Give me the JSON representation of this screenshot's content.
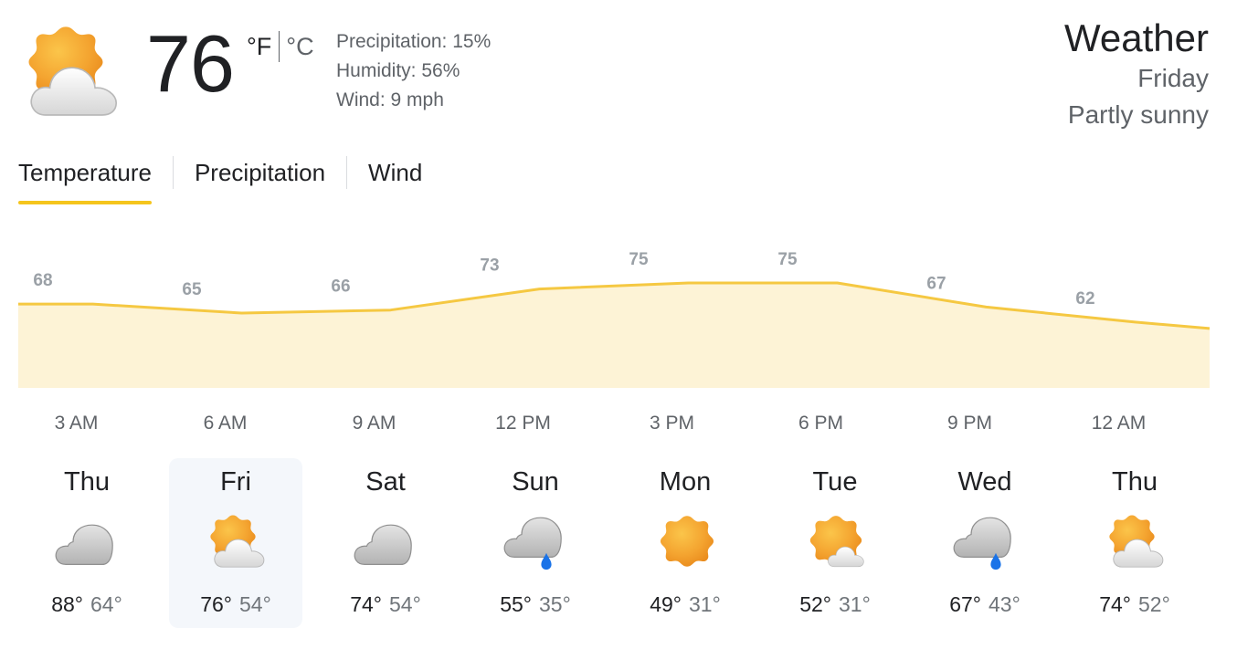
{
  "current": {
    "temperature": "76",
    "unit_f": "°F",
    "unit_c": "°C",
    "icon": "partly-sunny-icon",
    "precipitation": "Precipitation: 15%",
    "humidity": "Humidity: 56%",
    "wind": "Wind: 9 mph"
  },
  "header": {
    "title": "Weather",
    "day": "Friday",
    "condition": "Partly sunny"
  },
  "tabs": [
    {
      "label": "Temperature",
      "active": true
    },
    {
      "label": "Precipitation",
      "active": false
    },
    {
      "label": "Wind",
      "active": false
    }
  ],
  "colors": {
    "accent": "#f5c51d",
    "area_fill": "#fdf3d6",
    "line": "#f5c842",
    "rain": "#1a73e8"
  },
  "chart_data": {
    "type": "area",
    "x": [
      "3 AM",
      "6 AM",
      "9 AM",
      "12 PM",
      "3 PM",
      "6 PM",
      "9 PM",
      "12 AM"
    ],
    "values": [
      68,
      65,
      66,
      73,
      75,
      75,
      67,
      62
    ],
    "labels": [
      "68",
      "65",
      "66",
      "73",
      "75",
      "75",
      "67",
      "62"
    ]
  },
  "forecast": [
    {
      "day": "Thu",
      "high": "88°",
      "low": "64°",
      "icon": "cloudy-icon",
      "selected": false
    },
    {
      "day": "Fri",
      "high": "76°",
      "low": "54°",
      "icon": "partly-sunny-icon",
      "selected": true
    },
    {
      "day": "Sat",
      "high": "74°",
      "low": "54°",
      "icon": "cloudy-icon",
      "selected": false
    },
    {
      "day": "Sun",
      "high": "55°",
      "low": "35°",
      "icon": "rain-icon",
      "selected": false
    },
    {
      "day": "Mon",
      "high": "49°",
      "low": "31°",
      "icon": "sunny-icon",
      "selected": false
    },
    {
      "day": "Tue",
      "high": "52°",
      "low": "31°",
      "icon": "mostly-sunny-icon",
      "selected": false
    },
    {
      "day": "Wed",
      "high": "67°",
      "low": "43°",
      "icon": "rain-icon",
      "selected": false
    },
    {
      "day": "Thu",
      "high": "74°",
      "low": "52°",
      "icon": "partly-sunny-icon",
      "selected": false
    }
  ]
}
